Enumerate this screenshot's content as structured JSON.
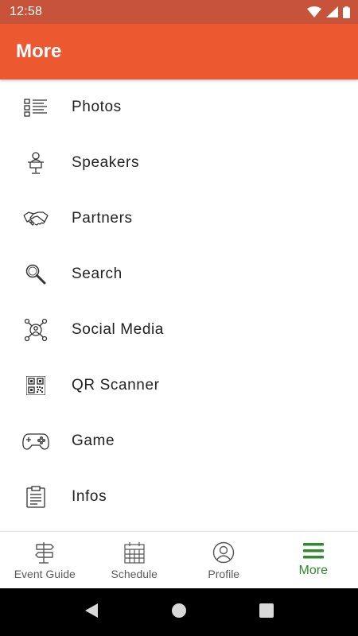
{
  "status_bar": {
    "time": "12:58"
  },
  "app_bar": {
    "title": "More"
  },
  "menu": {
    "items": [
      {
        "label": "Photos",
        "icon": "list-icon"
      },
      {
        "label": "Speakers",
        "icon": "speaker-icon"
      },
      {
        "label": "Partners",
        "icon": "handshake-icon"
      },
      {
        "label": "Search",
        "icon": "search-icon"
      },
      {
        "label": "Social Media",
        "icon": "social-network-icon"
      },
      {
        "label": "QR Scanner",
        "icon": "qr-code-icon"
      },
      {
        "label": "Game",
        "icon": "gamepad-icon"
      },
      {
        "label": "Infos",
        "icon": "clipboard-icon"
      }
    ]
  },
  "bottom_nav": {
    "items": [
      {
        "label": "Event Guide",
        "icon": "signpost-icon",
        "active": false
      },
      {
        "label": "Schedule",
        "icon": "calendar-icon",
        "active": false
      },
      {
        "label": "Profile",
        "icon": "user-circle-icon",
        "active": false
      },
      {
        "label": "More",
        "icon": "hamburger-menu-icon",
        "active": true
      }
    ]
  },
  "colors": {
    "status_bar": "#c7543a",
    "app_bar": "#ec5830",
    "active_nav": "#2e8b2e",
    "text": "#212121",
    "inactive_nav": "#5a5a5a"
  }
}
